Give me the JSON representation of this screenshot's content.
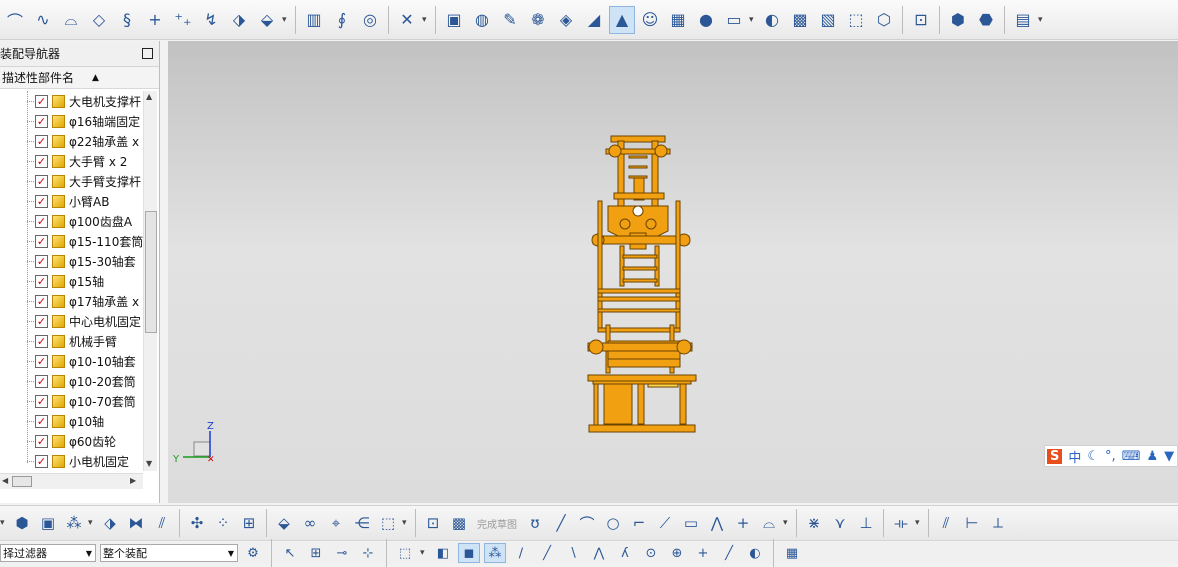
{
  "navigator": {
    "title": "装配导航器",
    "column_header": "描述性部件名",
    "parts": [
      "大电机支撑杆",
      "φ16轴端固定",
      "φ22轴承盖 x",
      "大手臂 x 2",
      "大手臂支撑杆",
      "小臂AB",
      "φ100齿盘A",
      "φ15-110套筒",
      "φ15-30轴套",
      "φ15轴",
      "φ17轴承盖 x",
      "中心电机固定",
      "机械手臂",
      "φ10-10轴套",
      "φ10-20套筒",
      "φ10-70套筒",
      "φ10轴",
      "φ60齿轮",
      "小电机固定"
    ]
  },
  "viewport": {
    "triad": {
      "z": "Z",
      "y": "Y"
    },
    "ime_status": {
      "logo": "S",
      "mode": "中"
    }
  },
  "bottom_toolbar": {
    "finish_sketch": "完成草图"
  },
  "statusbar": {
    "type_filter": "择过滤器",
    "scope": "整个装配"
  },
  "colors": {
    "model": "#f0a010",
    "check": "#d00000",
    "accent": "#2b5797"
  }
}
